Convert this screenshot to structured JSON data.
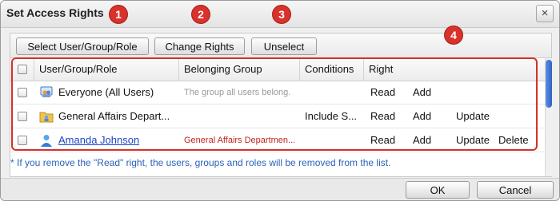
{
  "dialog": {
    "title": "Set Access Rights",
    "close_glyph": "×"
  },
  "toolbar": {
    "select_label": "Select User/Group/Role",
    "change_label": "Change Rights",
    "unselect_label": "Unselect"
  },
  "table": {
    "headers": {
      "name": "User/Group/Role",
      "group": "Belonging Group",
      "conditions": "Conditions",
      "right": "Right"
    },
    "rows": [
      {
        "icon": "users-icon",
        "name": "Everyone (All Users)",
        "group": "The group all users belong.",
        "conditions": "",
        "read": "Read",
        "add": "Add",
        "update": "",
        "delete": ""
      },
      {
        "icon": "group-folder-icon",
        "name": "General Affairs Depart...",
        "group": "",
        "conditions": "Include S...",
        "read": "Read",
        "add": "Add",
        "update": "Update",
        "delete": ""
      },
      {
        "icon": "user-icon",
        "name": "Amanda Johnson",
        "group": "General Affairs Departmen...",
        "conditions": "",
        "read": "Read",
        "add": "Add",
        "update": "Update",
        "delete": "Delete"
      }
    ]
  },
  "note": "* If you remove the \"Read\" right, the users, groups and roles will be removed from the list.",
  "footer": {
    "ok_label": "OK",
    "cancel_label": "Cancel"
  },
  "callouts": [
    "1",
    "2",
    "3",
    "4"
  ],
  "colors": {
    "callout": "#d9312b",
    "link": "#1a45c6",
    "note": "#2a63b8"
  }
}
